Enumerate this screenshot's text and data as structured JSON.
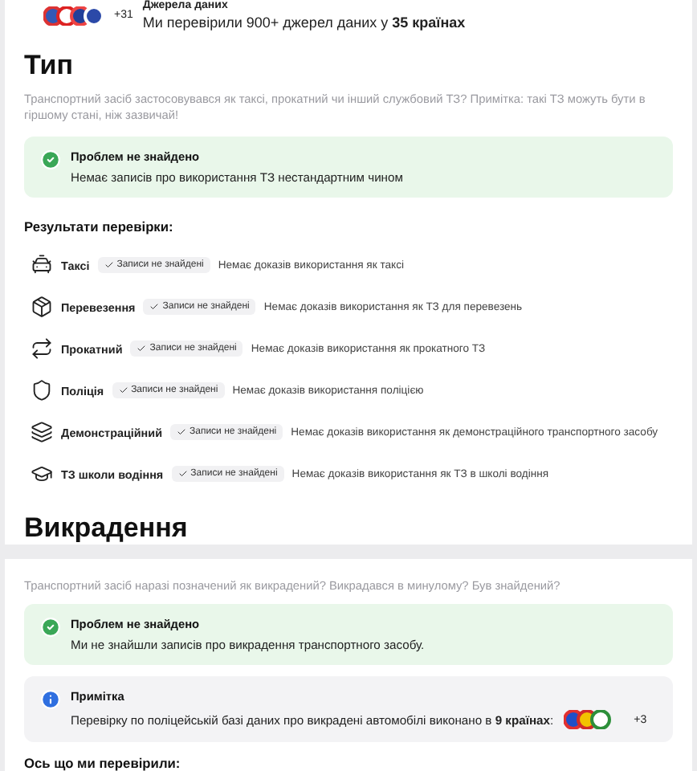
{
  "sources": {
    "title": "Джерела даних",
    "more": "+31",
    "text": "Ми перевірили 900+ джерел даних у **35 країнах**"
  },
  "type_section": {
    "title": "Тип",
    "description": "Транспортний засіб застосовувався як таксі, прокатний чи інший службовий ТЗ? Примітка: такі ТЗ можуть бути в гіршому стані, ніж зазвичай!",
    "alerts": [
      {
        "kind": "success",
        "title": "Проблем не знайдено",
        "text": "Немає записів про використання ТЗ нестандартним чином"
      }
    ],
    "results_title": "Результати перевірки:",
    "results": [
      {
        "label": "Таксі",
        "status": "Записи не знайдені",
        "text": "Немає доказів використання як таксі"
      },
      {
        "label": "Перевезення",
        "status": "Записи не знайдені",
        "text": "Немає доказів використання як ТЗ для перевезень"
      },
      {
        "label": "Прокатний",
        "status": "Записи не знайдені",
        "text": "Немає доказів використання як прокатного ТЗ"
      },
      {
        "label": "Поліція",
        "status": "Записи не знайдені",
        "text": "Немає доказів використання поліцією"
      },
      {
        "label": "Демонстраційний",
        "status": "Записи не знайдені",
        "text": "Немає доказів використання як демонстраційного транспортного засобу"
      },
      {
        "label": "ТЗ школи водіння",
        "status": "Записи не знайдені",
        "text": "Немає доказів використання як ТЗ в школі водіння"
      }
    ]
  },
  "theft_section": {
    "title": "Викрадення",
    "description": "Транспортний засіб наразі позначений як викрадений? Викрадався в минулому? Був знайдений?",
    "alerts": [
      {
        "kind": "success",
        "title": "Проблем не знайдено",
        "text": "Ми не знайшли записів про викрадення транспортного засобу."
      },
      {
        "kind": "info",
        "title": "Примітка",
        "text": "Перевірку по поліцейській базі даних про викрадені автомобілі виконано в **9 країнах**:",
        "more": "+3"
      }
    ],
    "checked_title": "Ось що ми перевірили:"
  }
}
